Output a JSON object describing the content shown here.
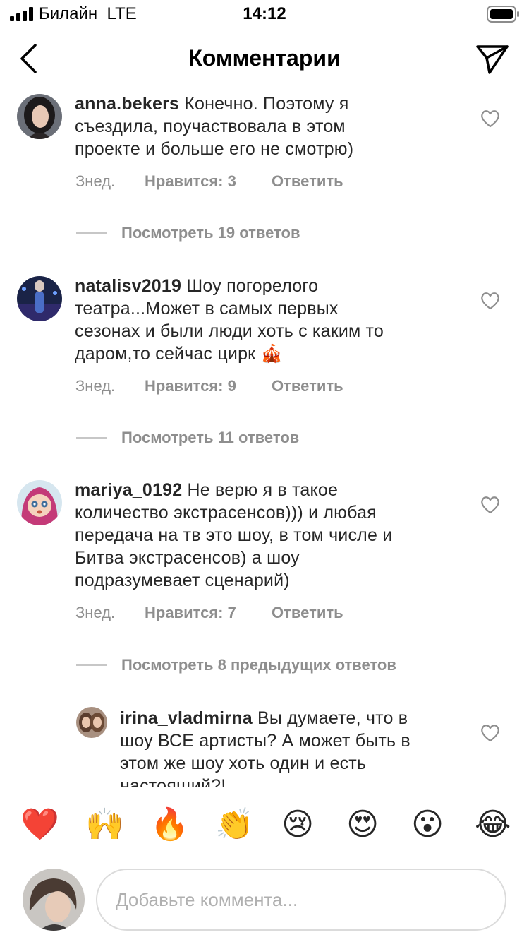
{
  "status_bar": {
    "carrier": "Билайн",
    "network": "LTE",
    "time": "14:12"
  },
  "header": {
    "title": "Комментарии",
    "back_icon": "chevron-left-icon",
    "share_icon": "paper-plane-icon"
  },
  "comments": [
    {
      "username": "anna.bekers",
      "lines": [
        "Конечно. Поэтому я",
        "съездила, поучаствовала в этом",
        "проекте и больше его не смотрю)"
      ],
      "time": "Знед.",
      "likes": "Нравится: 3",
      "reply": "Ответить",
      "view_replies": "Посмотреть 19 ответов"
    },
    {
      "username": "natalisv2019",
      "lines": [
        "Шоу погорелого",
        "театра...Может в самых первых",
        "сезонах и были люди хоть с каким то",
        "даром,то сейчас цирк 🎪"
      ],
      "time": "Знед.",
      "likes": "Нравится: 9",
      "reply": "Ответить",
      "view_replies": "Посмотреть 11 ответов"
    },
    {
      "username": "mariya_0192",
      "lines": [
        "Не верю я в такое",
        "количество экстрасенсов))) и любая",
        "передача на тв это шоу, в том числе и",
        "Битва экстрасенсов) а шоу",
        "подразумевает сценарий)"
      ],
      "time": "Знед.",
      "likes": "Нравится: 7",
      "reply": "Ответить",
      "view_replies": "Посмотреть 8 предыдущих ответов"
    },
    {
      "username": "irina_vladmirna",
      "lines": [
        "Вы думаете, что в",
        "шоу ВСЕ артисты? А может быть в",
        "этом же шоу хоть один и есть",
        "настоящий?!"
      ]
    }
  ],
  "emoji_bar": [
    "❤️",
    "🙌",
    "🔥",
    "👏",
    "😢",
    "😍",
    "😮",
    "😂"
  ],
  "input": {
    "placeholder": "Добавьте коммента..."
  }
}
